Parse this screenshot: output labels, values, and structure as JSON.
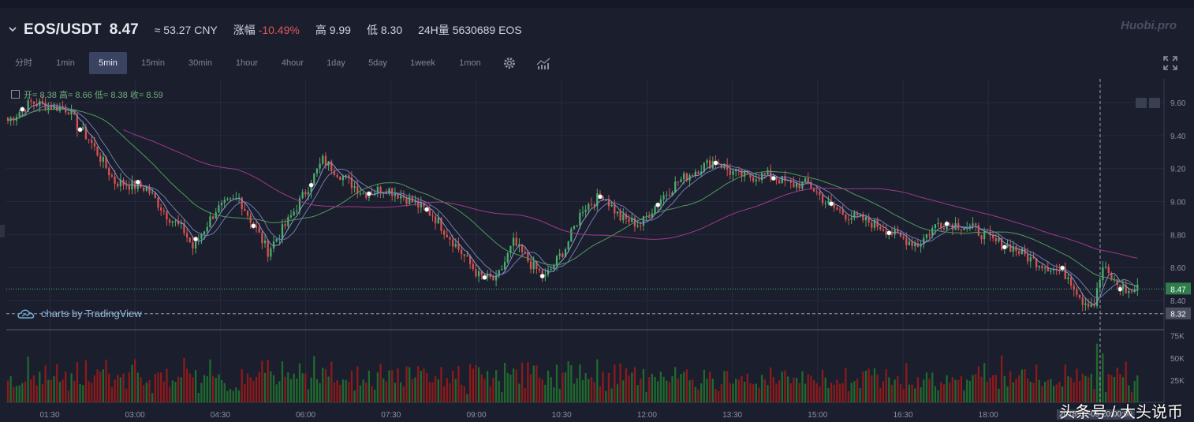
{
  "header": {
    "pair": "EOS/USDT",
    "last_price": "8.47",
    "cny": "≈ 53.27 CNY",
    "change_label": "涨幅",
    "change_value": "-10.49%",
    "high_label": "高",
    "high_value": "9.99",
    "low_label": "低",
    "low_value": "8.30",
    "volume_label": "24H量",
    "volume_value": "5630689 EOS",
    "logo": "Huobi.pro"
  },
  "toolbar": {
    "timeframes": [
      "分时",
      "1min",
      "5min",
      "15min",
      "30min",
      "1hour",
      "4hour",
      "1day",
      "5day",
      "1week",
      "1mon"
    ],
    "active": "5min"
  },
  "ohlc_legend": "开= 8.38 高= 8.66 低= 8.38 收= 8.59",
  "attribution": "charts by TradingView",
  "watermark": "头条号 / 大头说币",
  "timestamp": "2018-02-05 20:00:00",
  "colors": {
    "up": "#4caf6e",
    "down": "#d9534f",
    "vol_up": "#1f6b2e",
    "vol_down": "#8e1a1a",
    "ma_short": "#8a94c8",
    "ma_mid": "#4e9a5c",
    "ma_long": "#a03a8a",
    "background": "#1b1e2d"
  },
  "chart_data": {
    "type": "candlestick",
    "interval": "5min",
    "price_axis": {
      "ticks": [
        9.6,
        9.4,
        9.2,
        9.0,
        8.8,
        8.6,
        8.4
      ],
      "range": [
        8.25,
        9.7
      ]
    },
    "price_labels": {
      "last": "8.47",
      "crosshair": "8.32"
    },
    "volume_axis": {
      "ticks": [
        "75K",
        "50K",
        "25K"
      ],
      "range": [
        0,
        80000
      ]
    },
    "time_ticks": [
      "01:30",
      "03:00",
      "04:30",
      "06:00",
      "07:30",
      "09:00",
      "10:30",
      "12:00",
      "13:30",
      "15:00",
      "16:30",
      "18:00"
    ],
    "close_anchors": [
      [
        0,
        9.49
      ],
      [
        8,
        9.6
      ],
      [
        14,
        9.58
      ],
      [
        21,
        9.56
      ],
      [
        24,
        9.46
      ],
      [
        28,
        9.38
      ],
      [
        37,
        9.12
      ],
      [
        48,
        9.08
      ],
      [
        55,
        8.92
      ],
      [
        61,
        8.82
      ],
      [
        64,
        8.72
      ],
      [
        72,
        8.95
      ],
      [
        80,
        9.02
      ],
      [
        90,
        8.7
      ],
      [
        97,
        8.88
      ],
      [
        103,
        9.06
      ],
      [
        109,
        9.25
      ],
      [
        116,
        9.15
      ],
      [
        123,
        9.05
      ],
      [
        131,
        9.08
      ],
      [
        138,
        9.02
      ],
      [
        147,
        8.92
      ],
      [
        154,
        8.76
      ],
      [
        163,
        8.55
      ],
      [
        169,
        8.52
      ],
      [
        175,
        8.75
      ],
      [
        181,
        8.62
      ],
      [
        186,
        8.54
      ],
      [
        193,
        8.72
      ],
      [
        199,
        8.96
      ],
      [
        206,
        9.04
      ],
      [
        212,
        8.9
      ],
      [
        219,
        8.86
      ],
      [
        226,
        9.02
      ],
      [
        232,
        9.12
      ],
      [
        239,
        9.2
      ],
      [
        245,
        9.25
      ],
      [
        250,
        9.18
      ],
      [
        256,
        9.15
      ],
      [
        264,
        9.16
      ],
      [
        271,
        9.1
      ],
      [
        277,
        9.11
      ],
      [
        284,
        8.98
      ],
      [
        290,
        8.92
      ],
      [
        296,
        8.89
      ],
      [
        302,
        8.85
      ],
      [
        309,
        8.78
      ],
      [
        315,
        8.74
      ],
      [
        322,
        8.87
      ],
      [
        329,
        8.86
      ],
      [
        335,
        8.83
      ],
      [
        341,
        8.76
      ],
      [
        348,
        8.72
      ],
      [
        354,
        8.65
      ],
      [
        361,
        8.6
      ],
      [
        367,
        8.55
      ],
      [
        372,
        8.4
      ],
      [
        376,
        8.38
      ],
      [
        379,
        8.6
      ],
      [
        383,
        8.51
      ],
      [
        388,
        8.45
      ],
      [
        391,
        8.47
      ]
    ],
    "moving_averages": [
      "MA5",
      "MA10",
      "MA30",
      "MA60"
    ]
  }
}
